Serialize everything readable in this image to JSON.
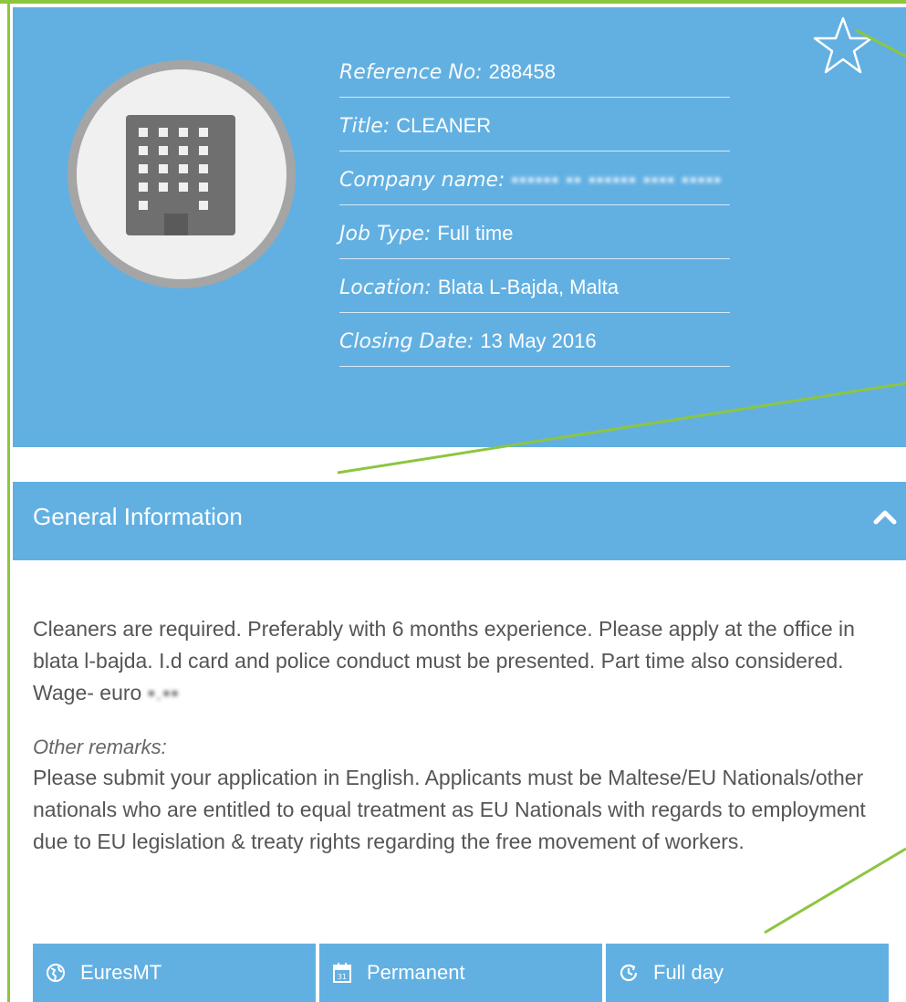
{
  "header": {
    "details": [
      {
        "label": "Reference No:",
        "value": "288458"
      },
      {
        "label": "Title:",
        "value": "CLEANER"
      },
      {
        "label": "Company name:",
        "value": "▪▪▪▪▪▪ ▪▪ ▪▪▪▪▪▪ ▪▪▪▪ ▪▪▪▪▪"
      },
      {
        "label": "Job Type:",
        "value": "Full time"
      },
      {
        "label": "Location:",
        "value": "Blata L-Bajda, Malta"
      },
      {
        "label": "Closing Date:",
        "value": "13 May 2016"
      }
    ],
    "logo_icon": "building-icon",
    "favorite_icon": "star-outline-icon"
  },
  "general_info": {
    "title": "General Information",
    "toggle_icon": "chevron-up-icon",
    "description": "Cleaners are required. Preferably with 6 months experience. Please apply at the office in blata l-bajda. I.d card and police conduct must be presented. Part time also considered. Wage- euro",
    "wage_redacted": "▪.▪▪",
    "remarks_label": "Other remarks:",
    "remarks": "Please submit your application in English. Applicants must be Maltese/EU Nationals/other nationals who are entitled to equal treatment as EU Nationals with regards to employment due to EU legislation & treaty rights regarding the free movement of workers."
  },
  "tags": [
    {
      "icon": "globe-icon",
      "label": "EuresMT"
    },
    {
      "icon": "calendar-icon",
      "label": "Permanent"
    },
    {
      "icon": "clock-icon",
      "label": "Full day"
    }
  ],
  "colors": {
    "accent": "#62b0e2",
    "annotation": "#8cc63f",
    "text": "#555555"
  }
}
